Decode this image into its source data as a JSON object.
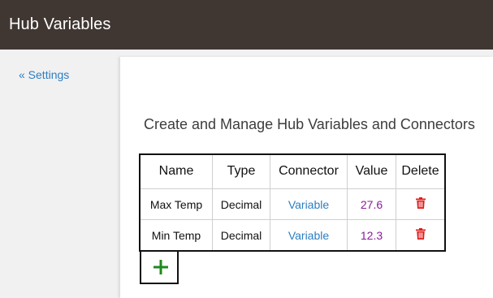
{
  "app": {
    "title": "Hub Variables"
  },
  "sidebar": {
    "back_link": "« Settings"
  },
  "main": {
    "heading": "Create and Manage Hub Variables and Connectors",
    "table": {
      "headers": {
        "name": "Name",
        "type": "Type",
        "connector": "Connector",
        "value": "Value",
        "delete": "Delete"
      },
      "rows": [
        {
          "name": "Max Temp",
          "type": "Decimal",
          "connector": "Variable",
          "value": "27.6"
        },
        {
          "name": "Min Temp",
          "type": "Decimal",
          "connector": "Variable",
          "value": "12.3"
        }
      ]
    },
    "icons": {
      "delete": "trash-icon",
      "add": "plus-icon"
    }
  },
  "colors": {
    "topbar": "#403733",
    "link": "#2c7ec1",
    "value": "#8a1a9b",
    "delete": "#e01b1b",
    "add": "#1e8a1e"
  }
}
